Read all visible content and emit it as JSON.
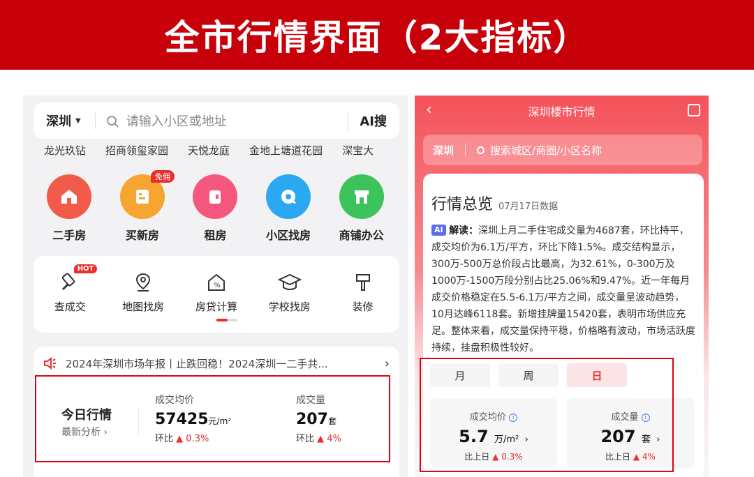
{
  "banner": {
    "title": "全市行情界面（2大指标）"
  },
  "left": {
    "search": {
      "city": "深圳",
      "placeholder": "请输入小区或地址",
      "ai_label": "AI搜"
    },
    "hot_tags": [
      "龙光玖钻",
      "招商领玺家园",
      "天悦龙庭",
      "金地上塘道花园",
      "深宝大"
    ],
    "categories": [
      {
        "label": "二手房",
        "color": "#f25b4a",
        "icon": "house-icon"
      },
      {
        "label": "买新房",
        "color": "#f7a531",
        "icon": "building-icon",
        "badge": "免佣"
      },
      {
        "label": "租房",
        "color": "#f5577f",
        "icon": "door-icon"
      },
      {
        "label": "小区找房",
        "color": "#2aa9f2",
        "icon": "search-icon"
      },
      {
        "label": "商铺办公",
        "color": "#3cc35b",
        "icon": "shop-icon"
      }
    ],
    "tools": [
      {
        "label": "查成交",
        "badge": "HOT",
        "icon": "gavel-icon"
      },
      {
        "label": "地图找房",
        "icon": "map-pin-icon"
      },
      {
        "label": "房贷计算",
        "icon": "calculator-house-icon"
      },
      {
        "label": "学校找房",
        "icon": "graduation-cap-icon"
      },
      {
        "label": "装修",
        "icon": "brush-icon"
      }
    ],
    "news": {
      "text": "2024年深圳市场年报丨止跌回稳！2024深圳一二手共...",
      "icon": "speaker-icon"
    },
    "today": {
      "title": "今日行情",
      "subtitle": "最新分析 ›",
      "avg_price": {
        "label": "成交均价",
        "value": "57425",
        "unit": "元/m²",
        "change_label": "环比",
        "change": "0.3%"
      },
      "volume": {
        "label": "成交量",
        "value": "207",
        "unit": "套",
        "change_label": "环比",
        "change": "4%"
      }
    }
  },
  "right": {
    "title": "深圳楼市行情",
    "search": {
      "city": "深圳",
      "placeholder": "搜索城区/商圈/小区名称"
    },
    "overview": {
      "title": "行情总览",
      "date": "07月17日数据",
      "ai_tag": "AI",
      "ai_label": "解读：",
      "ai_text": "深圳上月二手住宅成交量为4687套，环比持平，成交均价为6.1万/平方，环比下降1.5%。成交结构显示，300万-500万总价段占比最高，为32.61%，0-300万及1000万-1500万段分别占比25.06%和9.47%。近一年每月成交价格稳定在5.5-6.1万/平方之间，成交量呈波动趋势，10月达峰6118套。新增挂牌量15420套，表明市场供应充足。整体来看，成交量保持平稳，价格略有波动，市场活跃度持续，挂盘积极性较好。"
    },
    "tabs": [
      "月",
      "周",
      "日"
    ],
    "active_tab": "日",
    "avg_price": {
      "label": "成交均价",
      "value": "5.7",
      "unit": "万/m²",
      "change_label": "比上日",
      "change": "0.3%"
    },
    "volume": {
      "label": "成交量",
      "value": "207",
      "unit": "套",
      "change_label": "比上日",
      "change": "4%"
    }
  },
  "colors": {
    "banner": "#c8000a",
    "accent": "#e8302f",
    "highlight_box": "#e00010"
  }
}
